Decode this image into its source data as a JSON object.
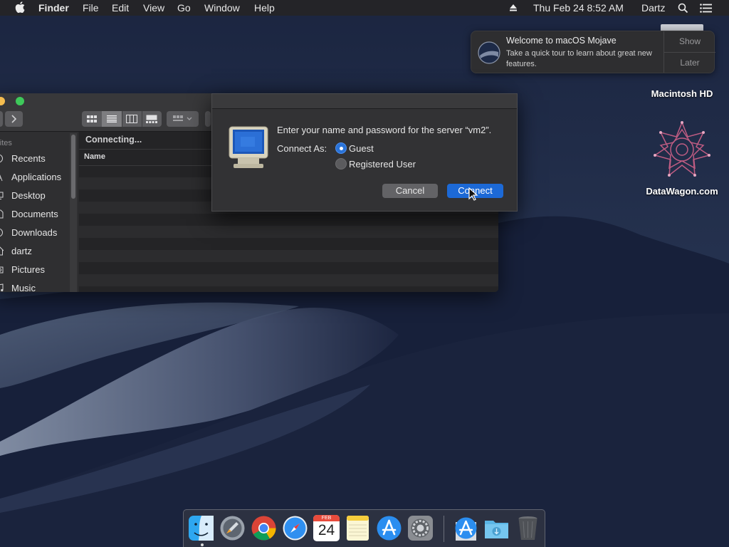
{
  "menubar": {
    "app_name": "Finder",
    "menus": [
      "File",
      "Edit",
      "View",
      "Go",
      "Window",
      "Help"
    ],
    "clock": "Thu Feb 24  8:52 AM",
    "user": "Dartz"
  },
  "notification": {
    "title": "Welcome to macOS Mojave",
    "body": "Take a quick tour to learn about great new features.",
    "show_label": "Show",
    "later_label": "Later"
  },
  "desktop_icons": [
    {
      "label": "Macintosh HD"
    },
    {
      "label": "DataWagon.com"
    }
  ],
  "finder": {
    "sidebar_section": "orites",
    "sidebar_items": [
      {
        "label": "Recents",
        "icon": "clock-icon"
      },
      {
        "label": "Applications",
        "icon": "applications-icon"
      },
      {
        "label": "Desktop",
        "icon": "desktop-icon"
      },
      {
        "label": "Documents",
        "icon": "document-icon"
      },
      {
        "label": "Downloads",
        "icon": "download-icon"
      },
      {
        "label": "dartz",
        "icon": "home-icon"
      },
      {
        "label": "Pictures",
        "icon": "camera-icon"
      },
      {
        "label": "Music",
        "icon": "music-icon"
      }
    ],
    "status": "Connecting...",
    "column_name": "Name"
  },
  "dialog": {
    "prompt": "Enter your name and password for the server “vm2”.",
    "connect_as_label": "Connect As:",
    "options": [
      {
        "label": "Guest",
        "selected": true
      },
      {
        "label": "Registered User",
        "selected": false
      }
    ],
    "cancel_label": "Cancel",
    "connect_label": "Connect"
  },
  "dock": {
    "items": [
      {
        "name": "finder-icon"
      },
      {
        "name": "launchpad-icon"
      },
      {
        "name": "chrome-icon"
      },
      {
        "name": "safari-icon"
      },
      {
        "name": "calendar-icon",
        "month": "FEB",
        "day": "24"
      },
      {
        "name": "notes-icon"
      },
      {
        "name": "app-store-icon"
      },
      {
        "name": "system-preferences-icon"
      },
      {
        "name": "app-store-downloads-icon"
      },
      {
        "name": "downloads-folder-icon"
      },
      {
        "name": "trash-icon"
      }
    ]
  },
  "colors": {
    "accent": "#1c69d6",
    "menubar": "#242428",
    "window": "#323234"
  }
}
